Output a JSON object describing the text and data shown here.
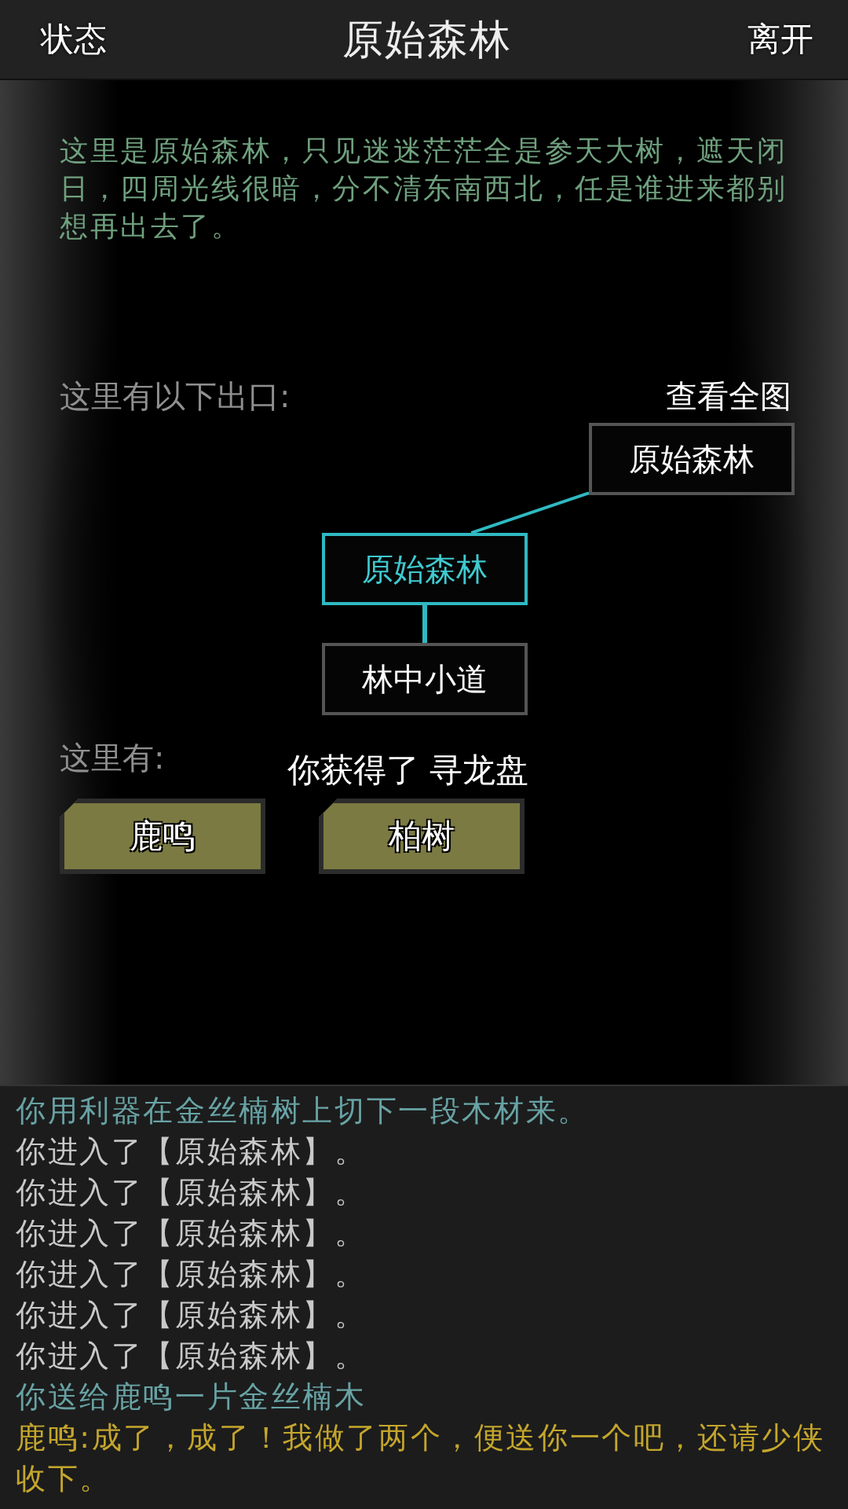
{
  "header": {
    "left": "状态",
    "title": "原始森林",
    "right": "离开"
  },
  "description": "这里是原始森林，只见迷迷茫茫全是参天大树，遮天闭日，四周光线很暗，分不清东南西北，任是谁进来都别想再出去了。",
  "exits": {
    "label": "这里有以下出口:",
    "view_map": "查看全图",
    "nodes": [
      {
        "label": "原始森林",
        "selected": false
      },
      {
        "label": "原始森林",
        "selected": true
      },
      {
        "label": "林中小道",
        "selected": false
      }
    ]
  },
  "here": {
    "label": "这里有:",
    "toast": "你获得了 寻龙盘",
    "items": [
      "鹿鸣",
      "柏树"
    ]
  },
  "log": [
    {
      "kind": "action",
      "text": "你用利器在金丝楠树上切下一段木材来。"
    },
    {
      "kind": "plain",
      "text": "你进入了【原始森林】。"
    },
    {
      "kind": "plain",
      "text": "你进入了【原始森林】。"
    },
    {
      "kind": "plain",
      "text": "你进入了【原始森林】。"
    },
    {
      "kind": "plain",
      "text": "你进入了【原始森林】。"
    },
    {
      "kind": "plain",
      "text": "你进入了【原始森林】。"
    },
    {
      "kind": "plain",
      "text": "你进入了【原始森林】。"
    },
    {
      "kind": "action",
      "text": "你送给鹿鸣一片金丝楠木"
    },
    {
      "kind": "speech",
      "text": "鹿鸣:成了，成了！我做了两个，便送你一个吧，还请少侠收下。"
    }
  ]
}
